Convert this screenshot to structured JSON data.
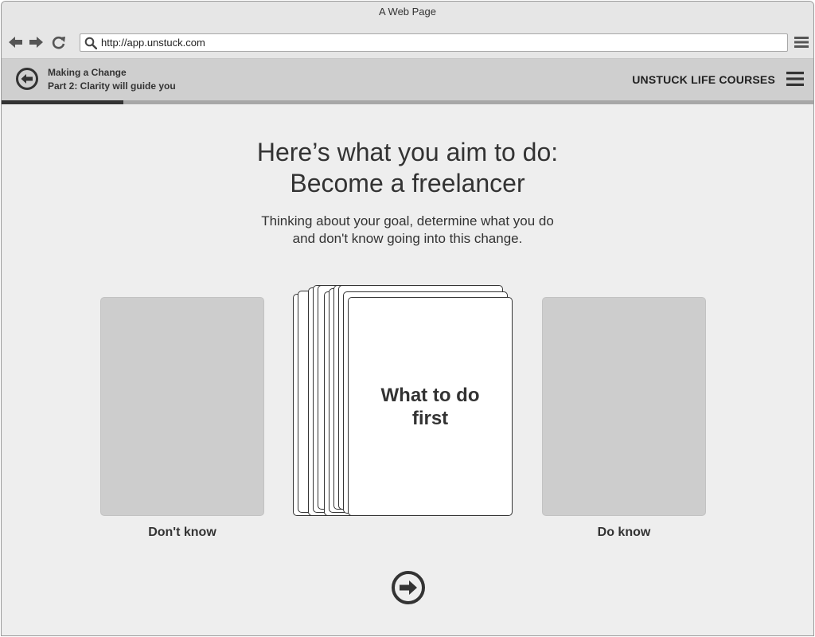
{
  "browser": {
    "window_title": "A Web Page",
    "url": "http://app.unstuck.com"
  },
  "app": {
    "breadcrumb_title": "Making a Change",
    "breadcrumb_subtitle": "Part 2: Clarity will guide you",
    "brand": "UNSTUCK LIFE COURSES",
    "progress": 0.15
  },
  "main": {
    "heading_line1": "Here’s what you aim to do:",
    "heading_line2": "Become a freelancer",
    "instruction_line1": "Thinking about your goal, determine what you do",
    "instruction_line2": "and don't know going into this change.",
    "top_card_text": "What to do first",
    "left_bin_label": "Don't know",
    "right_bin_label": "Do know"
  },
  "icons": {
    "back": "arrow-left-icon",
    "forward": "arrow-right-icon",
    "reload": "reload-icon",
    "search": "search-icon",
    "menu": "hamburger-icon",
    "app_back": "circle-arrow-left-icon",
    "next": "circle-arrow-right-icon"
  },
  "colors": {
    "chrome": "#e6e6e6",
    "appbar": "#cfcfcf",
    "content_bg": "#eeeeee",
    "bin": "#cdcdcd",
    "dark": "#333333",
    "progress_track": "#a7a7a7"
  }
}
